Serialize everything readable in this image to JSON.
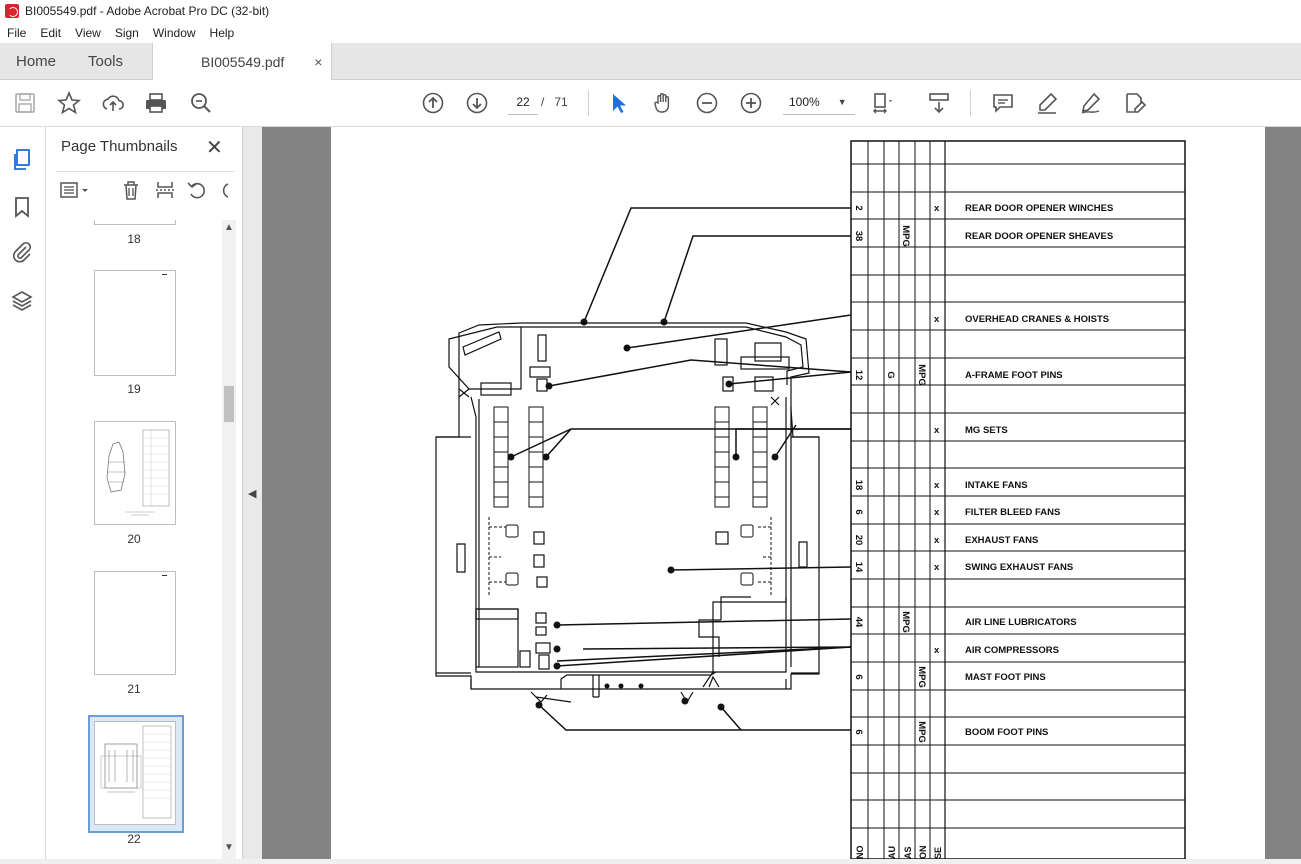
{
  "window": {
    "title": "BI005549.pdf - Adobe Acrobat Pro DC (32-bit)"
  },
  "menu": [
    "File",
    "Edit",
    "View",
    "Sign",
    "Window",
    "Help"
  ],
  "tabs": {
    "home": "Home",
    "tools": "Tools",
    "document": "BI005549.pdf",
    "close": "×"
  },
  "toolbar": {
    "current_page": "22",
    "page_separator": "/",
    "total_pages": "71",
    "zoom": "100%"
  },
  "panel": {
    "title": "Page Thumbnails",
    "close": "✕",
    "thumbnails": [
      "18",
      "19",
      "20",
      "21",
      "22"
    ],
    "selected": "22"
  },
  "document": {
    "rows": [
      {
        "qty": "2",
        "col2": "",
        "col3": "",
        "col4": "",
        "col5": "x",
        "name": "REAR DOOR OPENER WINCHES"
      },
      {
        "qty": "38",
        "col2": "",
        "col3": "MPG",
        "col4": "",
        "col5": "",
        "name": "REAR DOOR OPENER SHEAVES"
      },
      {
        "qty": "",
        "col2": "",
        "col3": "",
        "col4": "",
        "col5": "x",
        "name": "OVERHEAD CRANES & HOISTS"
      },
      {
        "qty": "12",
        "col2": "G",
        "col3": "",
        "col4": "MPG",
        "col5": "",
        "name": "A-FRAME FOOT PINS"
      },
      {
        "qty": "",
        "col2": "",
        "col3": "",
        "col4": "",
        "col5": "x",
        "name": "MG SETS"
      },
      {
        "qty": "18",
        "col2": "",
        "col3": "",
        "col4": "",
        "col5": "x",
        "name": "INTAKE FANS"
      },
      {
        "qty": "6",
        "col2": "",
        "col3": "",
        "col4": "",
        "col5": "x",
        "name": "FILTER BLEED FANS"
      },
      {
        "qty": "20",
        "col2": "",
        "col3": "",
        "col4": "",
        "col5": "x",
        "name": "EXHAUST FANS"
      },
      {
        "qty": "14",
        "col2": "",
        "col3": "",
        "col4": "",
        "col5": "x",
        "name": "SWING EXHAUST FANS"
      },
      {
        "qty": "44",
        "col2": "",
        "col3": "MPG",
        "col4": "",
        "col5": "",
        "name": "AIR LINE LUBRICATORS"
      },
      {
        "qty": "",
        "col2": "",
        "col3": "",
        "col4": "",
        "col5": "x",
        "name": "AIR COMPRESSORS"
      },
      {
        "qty": "6",
        "col2": "",
        "col3": "",
        "col4": "MPG",
        "col5": "",
        "name": "MAST FOOT PINS"
      },
      {
        "qty": "6",
        "col2": "",
        "col3": "",
        "col4": "MPG",
        "col5": "",
        "name": "BOOM FOOT PINS"
      }
    ],
    "column_headers": [
      "NO",
      "AU",
      "AS",
      "ON",
      "SE"
    ]
  }
}
